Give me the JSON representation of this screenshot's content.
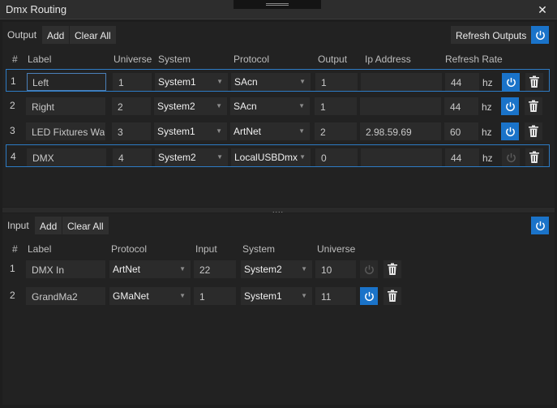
{
  "window": {
    "title": "Dmx Routing"
  },
  "output": {
    "section_label": "Output",
    "add_label": "Add",
    "clear_label": "Clear All",
    "refresh_label": "Refresh Outputs",
    "columns": [
      "#",
      "Label",
      "Universe",
      "System",
      "Protocol",
      "Output",
      "Ip Address",
      "Refresh Rate"
    ],
    "hz_label": "hz",
    "rows": [
      {
        "index": "1",
        "label": "Left",
        "universe": "1",
        "system": "System1",
        "protocol": "SAcn",
        "output": "1",
        "ip": "",
        "refresh": "44",
        "enabled": true,
        "selected": true
      },
      {
        "index": "2",
        "label": "Right",
        "universe": "2",
        "system": "System2",
        "protocol": "SAcn",
        "output": "1",
        "ip": "",
        "refresh": "44",
        "enabled": true,
        "selected": false
      },
      {
        "index": "3",
        "label": "LED Fixtures Wall",
        "universe": "3",
        "system": "System1",
        "protocol": "ArtNet",
        "output": "2",
        "ip": "2.98.59.69",
        "refresh": "60",
        "enabled": true,
        "selected": false
      },
      {
        "index": "4",
        "label": "DMX",
        "universe": "4",
        "system": "System2",
        "protocol": "LocalUSBDmx",
        "output": "0",
        "ip": "",
        "refresh": "44",
        "enabled": false,
        "selected": true
      }
    ]
  },
  "input": {
    "section_label": "Input",
    "add_label": "Add",
    "clear_label": "Clear All",
    "columns": [
      "#",
      "Label",
      "Protocol",
      "Input",
      "System",
      "Universe"
    ],
    "rows": [
      {
        "index": "1",
        "label": "DMX In",
        "protocol": "ArtNet",
        "input": "22",
        "system": "System2",
        "universe": "10",
        "enabled": false
      },
      {
        "index": "2",
        "label": "GrandMa2",
        "protocol": "GMaNet",
        "input": "1",
        "system": "System1",
        "universe": "11",
        "enabled": true
      }
    ]
  },
  "icons": {
    "power": "power-icon",
    "trash": "trash-icon",
    "close": "close-icon",
    "chevron": "chevron-down-icon"
  },
  "colors": {
    "accent": "#1a73c9",
    "selection": "#2d7bc4",
    "background": "#1e1e1e"
  }
}
